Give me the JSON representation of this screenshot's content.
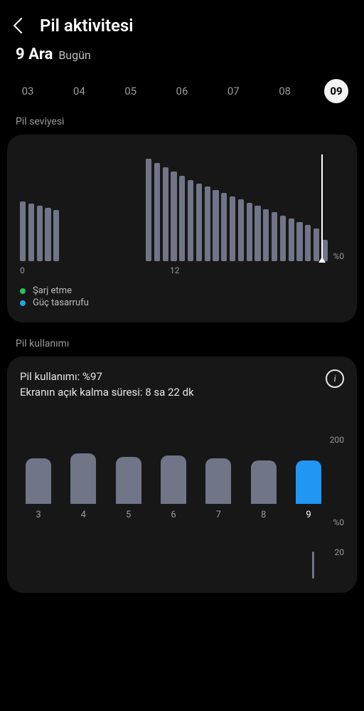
{
  "header": {
    "title": "Pil aktivitesi"
  },
  "date": {
    "main": "9 Ara",
    "sub": "Bugün"
  },
  "days": [
    {
      "label": "03",
      "sel": false
    },
    {
      "label": "04",
      "sel": false
    },
    {
      "label": "05",
      "sel": false
    },
    {
      "label": "06",
      "sel": false
    },
    {
      "label": "07",
      "sel": false
    },
    {
      "label": "08",
      "sel": false
    },
    {
      "label": "09",
      "sel": true
    }
  ],
  "level": {
    "section_label": "Pil seviyesi",
    "zero_label": "%0",
    "ticks": {
      "t0": "0",
      "t1": "12"
    },
    "legend": {
      "charging": "Şarj etme",
      "powersave": "Güç tasarrufu"
    }
  },
  "usage": {
    "section_label": "Pil kullanımı",
    "line1": "Pil kullanımı: %97",
    "line2": "Ekranın açık kalma süresi: 8 sa 22 dk",
    "max_label": "200",
    "zero_label": "%0",
    "bottom_max": "20"
  },
  "chart_data": [
    {
      "type": "bar",
      "title": "Pil seviyesi",
      "ylabel": "%",
      "ylim": [
        0,
        100
      ],
      "x": [
        0,
        1,
        2,
        3,
        4,
        5,
        6,
        7,
        8,
        9,
        10,
        11,
        12,
        13,
        14,
        15,
        16,
        17,
        18,
        19,
        20,
        21,
        22,
        23,
        24,
        25,
        26,
        27,
        28,
        29,
        30,
        31,
        32,
        33,
        34,
        35,
        36
      ],
      "values": [
        56,
        54,
        52,
        50,
        48,
        null,
        null,
        null,
        null,
        null,
        null,
        null,
        null,
        null,
        null,
        96,
        92,
        88,
        84,
        80,
        76,
        73,
        70,
        67,
        64,
        61,
        58,
        55,
        52,
        49,
        46,
        43,
        40,
        37,
        34,
        31,
        20
      ],
      "xticks": {
        "0": "0",
        "18": "12"
      }
    },
    {
      "type": "bar",
      "title": "Pil kullanımı",
      "ylim": [
        0,
        200
      ],
      "categories": [
        "3",
        "4",
        "5",
        "6",
        "7",
        "8",
        "9"
      ],
      "values": [
        115,
        128,
        120,
        122,
        115,
        110,
        110
      ]
    }
  ]
}
